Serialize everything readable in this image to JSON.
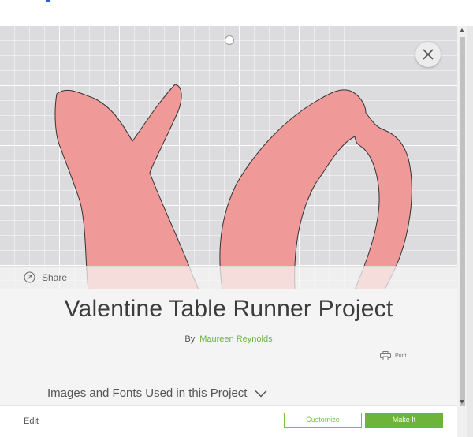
{
  "modal": {
    "share_label": "Share",
    "title": "Valentine Table Runner Project",
    "by_label": "By",
    "author": "Maureen Reynolds",
    "print_label": "Print",
    "images_fonts_label": "Images and Fonts Used in this Project",
    "edit_label": "Edit",
    "customize_label": "Customize",
    "make_it_label": "Make It"
  },
  "icons": {
    "close": "close-icon",
    "share": "share-icon",
    "print": "print-icon",
    "chevron": "chevron-down-icon"
  },
  "colors": {
    "shape_fill": "#ef9a98",
    "accent_green": "#6cb53a",
    "author_link": "#6db33f"
  }
}
